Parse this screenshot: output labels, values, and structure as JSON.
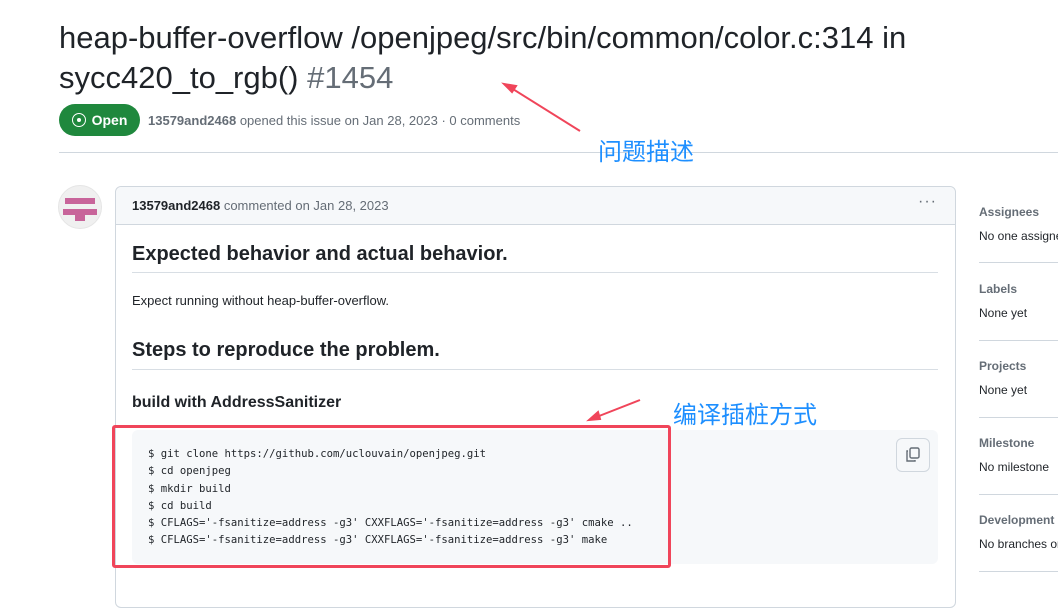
{
  "issue": {
    "title": "heap-buffer-overflow /openjpeg/src/bin/common/color.c:314 in sycc420_to_rgb()",
    "number": "#1454",
    "status": "Open",
    "author": "13579and2468",
    "meta_text": "opened this issue on Jan 28, 2023 · 0 comments"
  },
  "comment": {
    "author": "13579and2468",
    "meta": "commented on Jan 28, 2023",
    "menu": "···",
    "h2_1": "Expected behavior and actual behavior.",
    "p1": "Expect running without heap-buffer-overflow.",
    "h2_2": "Steps to reproduce the problem.",
    "h3": "build with AddressSanitizer",
    "code": "$ git clone https://github.com/uclouvain/openjpeg.git\n$ cd openjpeg\n$ mkdir build\n$ cd build\n$ CFLAGS='-fsanitize=address -g3' CXXFLAGS='-fsanitize=address -g3' cmake ..\n$ CFLAGS='-fsanitize=address -g3' CXXFLAGS='-fsanitize=address -g3' make"
  },
  "sidebar": [
    {
      "label": "Assignees",
      "value": "No one assigne"
    },
    {
      "label": "Labels",
      "value": "None yet"
    },
    {
      "label": "Projects",
      "value": "None yet"
    },
    {
      "label": "Milestone",
      "value": "No milestone"
    },
    {
      "label": "Development",
      "value": "No branches or"
    }
  ],
  "annotations": {
    "a1": "问题描述",
    "a2": "编译插桩方式",
    "color": "#1e8fff",
    "arrow_color": "#f0455a"
  }
}
